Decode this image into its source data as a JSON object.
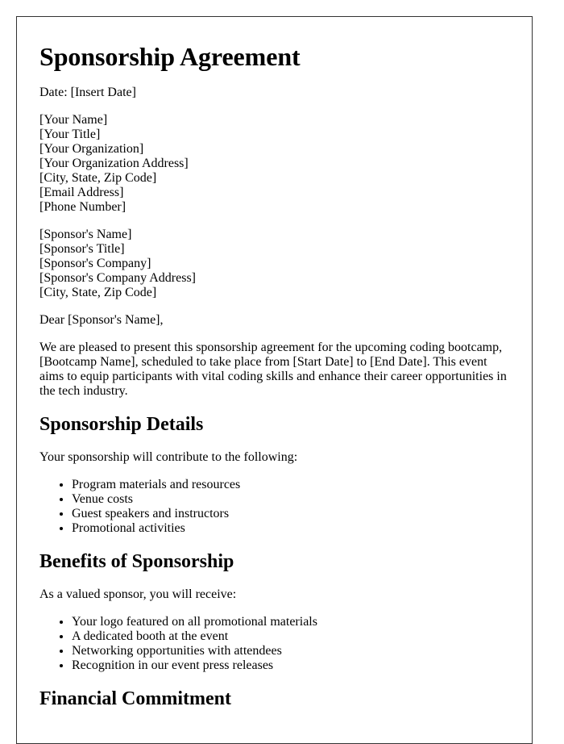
{
  "document": {
    "title": "Sponsorship Agreement",
    "date_line": "Date: [Insert Date]",
    "sender": [
      "[Your Name]",
      "[Your Title]",
      "[Your Organization]",
      "[Your Organization Address]",
      "[City, State, Zip Code]",
      "[Email Address]",
      "[Phone Number]"
    ],
    "recipient": [
      "[Sponsor's Name]",
      "[Sponsor's Title]",
      "[Sponsor's Company]",
      "[Sponsor's Company Address]",
      "[City, State, Zip Code]"
    ],
    "salutation": "Dear [Sponsor's Name],",
    "intro": "We are pleased to present this sponsorship agreement for the upcoming coding bootcamp, [Bootcamp Name], scheduled to take place from [Start Date] to [End Date]. This event aims to equip participants with vital coding skills and enhance their career opportunities in the tech industry.",
    "sections": [
      {
        "heading": "Sponsorship Details",
        "lead": "Your sponsorship will contribute to the following:",
        "items": [
          "Program materials and resources",
          "Venue costs",
          "Guest speakers and instructors",
          "Promotional activities"
        ]
      },
      {
        "heading": "Benefits of Sponsorship",
        "lead": "As a valued sponsor, you will receive:",
        "items": [
          "Your logo featured on all promotional materials",
          "A dedicated booth at the event",
          "Networking opportunities with attendees",
          "Recognition in our event press releases"
        ]
      },
      {
        "heading": "Financial Commitment"
      }
    ]
  }
}
